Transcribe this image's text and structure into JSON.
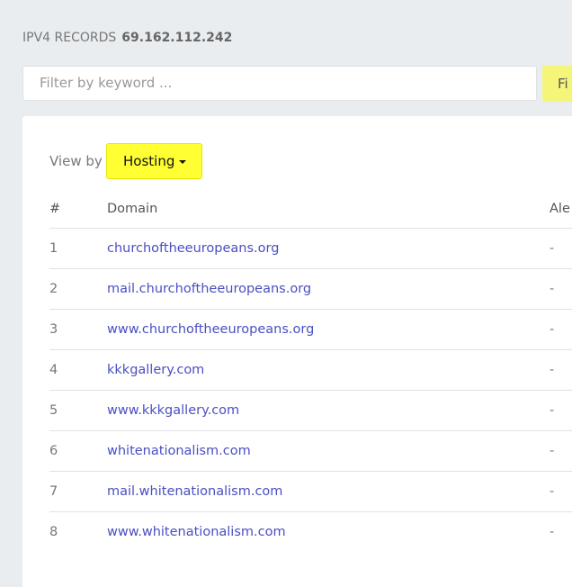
{
  "header": {
    "label": "IPV4 RECORDS",
    "ip": "69.162.112.242"
  },
  "filter": {
    "placeholder": "Filter by keyword ...",
    "button_label": "Fi"
  },
  "view_by": {
    "label": "View by",
    "selected": "Hosting"
  },
  "table": {
    "columns": [
      "#",
      "Domain",
      "Ale"
    ],
    "rows": [
      {
        "n": "1",
        "domain": "churchoftheeuropeans.org",
        "alexa": "-"
      },
      {
        "n": "2",
        "domain": "mail.churchoftheeuropeans.org",
        "alexa": "-"
      },
      {
        "n": "3",
        "domain": "www.churchoftheeuropeans.org",
        "alexa": "-"
      },
      {
        "n": "4",
        "domain": "kkkgallery.com",
        "alexa": "-"
      },
      {
        "n": "5",
        "domain": "www.kkkgallery.com",
        "alexa": "-"
      },
      {
        "n": "6",
        "domain": "whitenationalism.com",
        "alexa": "-"
      },
      {
        "n": "7",
        "domain": "mail.whitenationalism.com",
        "alexa": "-"
      },
      {
        "n": "8",
        "domain": "www.whitenationalism.com",
        "alexa": "-"
      }
    ]
  },
  "colors": {
    "accent_yellow": "#ffff33",
    "link": "#4a4fc2",
    "background": "#e9edf0"
  }
}
